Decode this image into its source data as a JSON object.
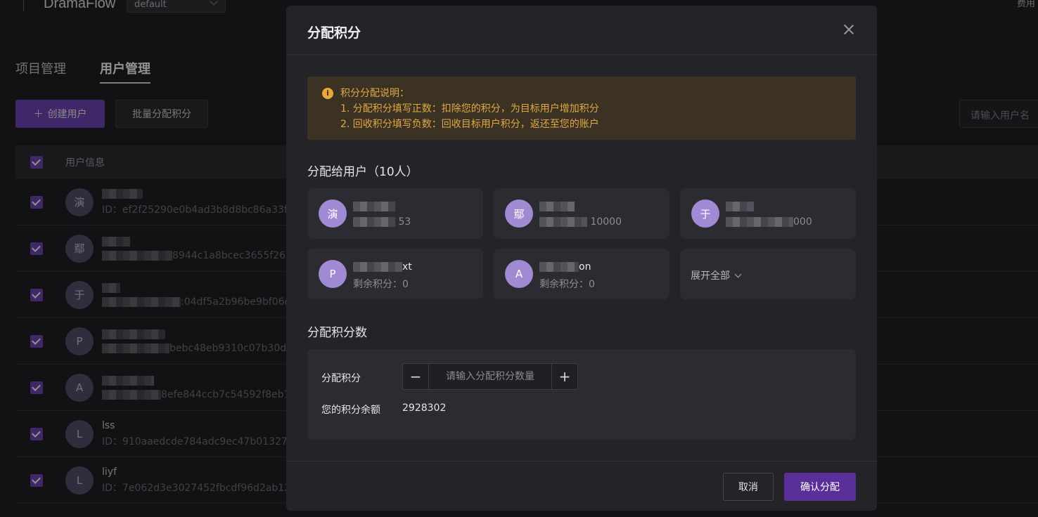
{
  "app": {
    "brand": "DramaFlow",
    "project_select": "default",
    "top_right": "费用"
  },
  "tabs": [
    {
      "label": "项目管理"
    },
    {
      "label": "用户管理"
    }
  ],
  "toolbar": {
    "create_user": "创建用户",
    "batch_assign": "批量分配积分",
    "search_placeholder": "请输入用户名"
  },
  "table": {
    "header": "用户信息",
    "rows": [
      {
        "avatar": "演",
        "name": "",
        "id": "ID：ef2f25290e0b4ad3b8d8bc86a33f2a"
      },
      {
        "avatar": "鄢",
        "name": "",
        "id": "8944c1a8bcec3655f26b"
      },
      {
        "avatar": "于",
        "name": "",
        "id": ":04df5a2b96be9bf06e"
      },
      {
        "avatar": "P",
        "name": "",
        "id": "bebc48eb9310c07b30d1c"
      },
      {
        "avatar": "A",
        "name": "",
        "id": "8efe844ccb7c54592f8eb1"
      },
      {
        "avatar": "L",
        "name": "lss",
        "id": "ID：910aaedcde784adc9ec47b013273"
      },
      {
        "avatar": "L",
        "name": "liyf",
        "id": "ID：7e062d3e3027452fbcdf96d2ab12d"
      }
    ]
  },
  "modal": {
    "title": "分配积分",
    "notice": {
      "title": "积分分配说明：",
      "line1": "1. 分配积分填写正数：扣除您的积分，为目标用户增加积分",
      "line2": "2. 回收积分填写负数：回收目标用户积分，返还至您的账户"
    },
    "assign_to_title": "分配给用户（10人）",
    "users": [
      {
        "avatar": "演",
        "name": "",
        "points": "53"
      },
      {
        "avatar": "鄢",
        "name": "",
        "points": "10000"
      },
      {
        "avatar": "于",
        "name": "",
        "points": "000"
      },
      {
        "avatar": "P",
        "name": "xt",
        "points": "剩余积分：0"
      },
      {
        "avatar": "A",
        "name": "on",
        "points": "剩余积分：0"
      }
    ],
    "expand_all": "展开全部",
    "points_section_title": "分配积分数",
    "points_label": "分配积分",
    "points_placeholder": "请输入分配积分数量",
    "balance_label": "您的积分余额",
    "balance_value": "2928302",
    "cancel": "取消",
    "confirm": "确认分配"
  }
}
